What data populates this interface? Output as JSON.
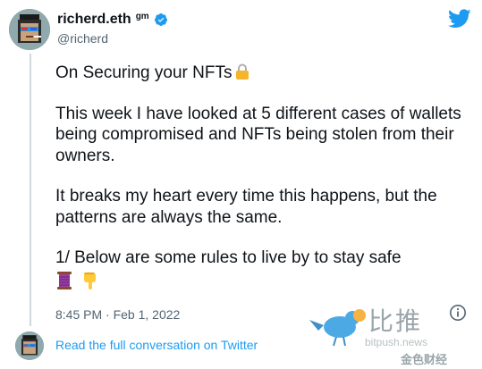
{
  "author": {
    "display_name": "richerd.eth",
    "name_suffix": "gm",
    "handle": "@richerd",
    "verified": true
  },
  "icons": {
    "brand": "twitter-bird-icon",
    "verified": "verified-badge-icon",
    "lock": "lock-icon",
    "thread": "thread-spool-icon",
    "point_down": "backhand-index-pointing-down-icon",
    "info": "info-icon"
  },
  "colors": {
    "twitter_blue": "#1d9bf0",
    "text": "#0f1419",
    "muted": "#536471"
  },
  "tweet": {
    "paragraphs": [
      "On Securing your NFTs",
      "This week I have looked at 5 different cases of wallets being compromised and NFTs being stolen from their owners.",
      "It breaks my heart every time this happens, but the patterns are always the same.",
      "1/ Below are some rules to live by to stay safe"
    ],
    "timestamp": "8:45 PM · Feb 1, 2022"
  },
  "footer": {
    "link_text": "Read the full conversation on Twitter"
  },
  "watermark": {
    "main": "比推",
    "sub": "bitpush.news",
    "sub2": "金色财经"
  }
}
